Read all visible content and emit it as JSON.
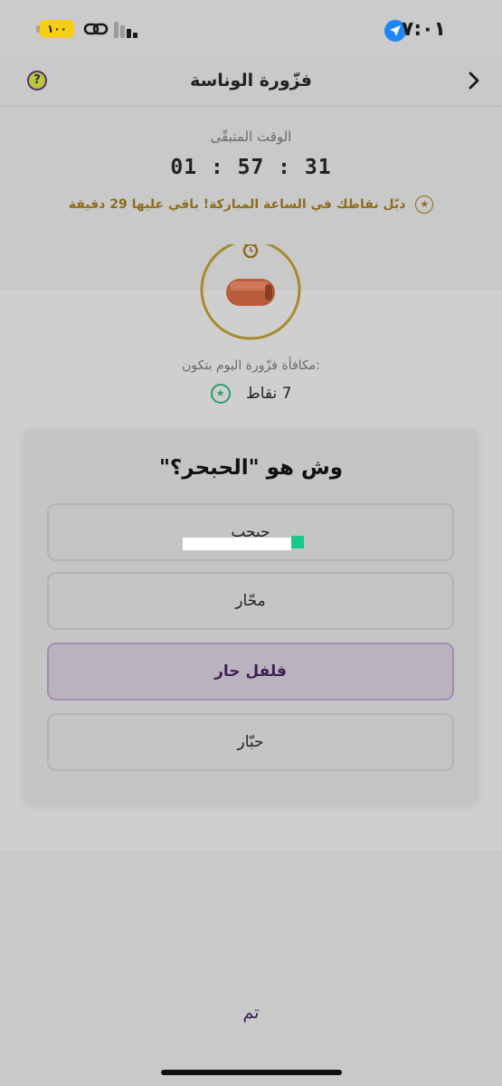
{
  "status_bar": {
    "time": "٧:٠١",
    "battery": "١٠٠"
  },
  "header": {
    "title": "فزّورة الوناسة"
  },
  "timer": {
    "label": "الوقت المتبقّى",
    "value": "01 : 57 : 31"
  },
  "promo": {
    "text": "دبّل نقاطك في الساعة المباركة! باقي عليها 29 دقيقة"
  },
  "reward": {
    "label": "مكافأة فزّورة اليوم بتكون:",
    "points": "7 نقاط"
  },
  "quiz": {
    "question": "وش هو \"الحبحر؟\"",
    "options": [
      {
        "label": "حبحب",
        "selected": false
      },
      {
        "label": "محّار",
        "selected": false
      },
      {
        "label": "فلفل حار",
        "selected": true
      },
      {
        "label": "حبّار",
        "selected": false
      }
    ]
  },
  "footer": {
    "done_label": "تم"
  },
  "colors": {
    "accent_purple": "#3f1f55",
    "gold": "#8c6d1c",
    "green": "#2d9e6c",
    "location_blue": "#1e86f5",
    "battery_yellow": "#f8cd15"
  },
  "icons": [
    "location-arrow-icon",
    "link-icon",
    "signal-icon",
    "help-icon",
    "back-chevron-icon",
    "star-icon",
    "stopwatch-icon",
    "date-fruit-icon"
  ]
}
